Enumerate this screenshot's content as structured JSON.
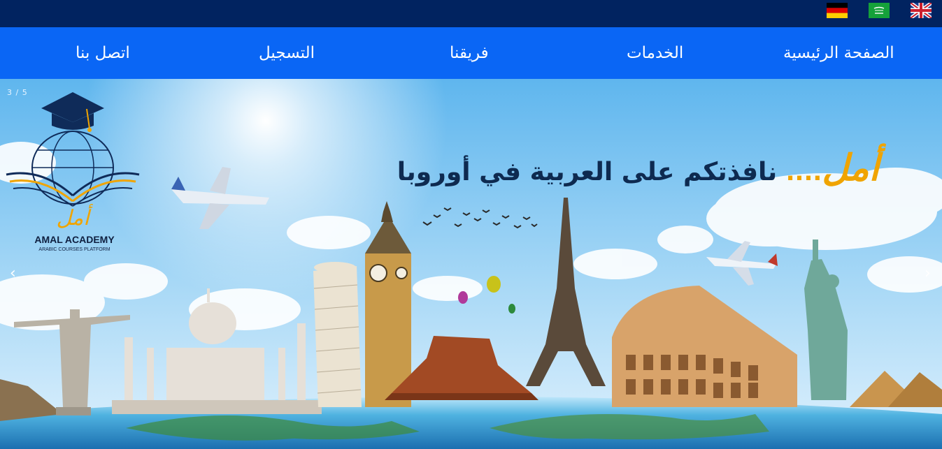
{
  "languages": [
    {
      "name": "German",
      "icon": "german-flag-icon"
    },
    {
      "name": "Arabic",
      "icon": "saudi-flag-icon"
    },
    {
      "name": "English",
      "icon": "uk-flag-icon"
    }
  ],
  "nav": {
    "home": "الصفحة الرئيسية",
    "services": "الخدمات",
    "team": "فريقنا",
    "register": "التسجيل",
    "contact": "اتصل بنا"
  },
  "slider": {
    "counter": "3 / 5",
    "prev_icon": "‹",
    "next_icon": "›"
  },
  "logo": {
    "arabic_name": "أمل",
    "title": "AMAL ACADEMY",
    "subtitle": "ARABIC COURSES PLATFORM"
  },
  "headline": {
    "amal": "أمل",
    "dots": "....",
    "rest": " نافذتكم على العربية في أوروبا"
  },
  "colors": {
    "topbar": "#012360",
    "nav": "#0a66f5",
    "accent": "#f0a400",
    "headline_text": "#0e2a50"
  }
}
